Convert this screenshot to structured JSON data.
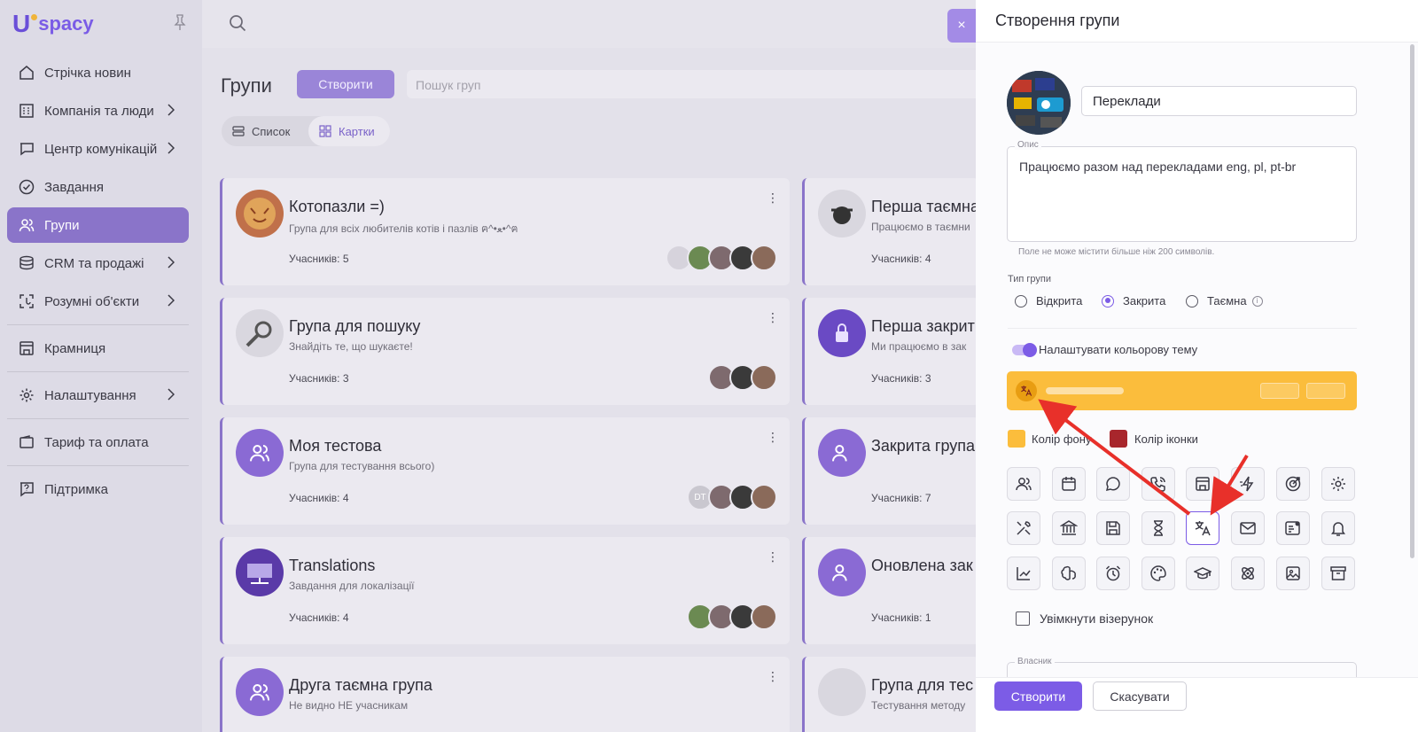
{
  "app": {
    "logo_u": "U",
    "logo_text": "spacy"
  },
  "sidebar": {
    "items": [
      {
        "label": "Стрічка новин",
        "icon": "news-icon",
        "chevron": false
      },
      {
        "label": "Компанія та люди",
        "icon": "company-icon",
        "chevron": true
      },
      {
        "label": "Центр комунікацій",
        "icon": "chat-icon",
        "chevron": true
      },
      {
        "label": "Завдання",
        "icon": "check-icon",
        "chevron": false
      },
      {
        "label": "Групи",
        "icon": "people-icon",
        "chevron": false,
        "active": true
      },
      {
        "label": "CRM та продажі",
        "icon": "coins-icon",
        "chevron": true
      },
      {
        "label": "Розумні об'єкти",
        "icon": "smart-object-icon",
        "chevron": true
      },
      {
        "label": "Крамниця",
        "icon": "store-icon",
        "chevron": false
      },
      {
        "label": "Налаштування",
        "icon": "gear-icon",
        "chevron": true
      },
      {
        "label": "Тариф та оплата",
        "icon": "wallet-icon",
        "chevron": false
      },
      {
        "label": "Підтримка",
        "icon": "help-icon",
        "chevron": false
      }
    ]
  },
  "groups_page": {
    "title": "Групи",
    "create_label": "Створити",
    "search_placeholder": "Пошук груп",
    "view_list": "Список",
    "view_cards": "Картки"
  },
  "cards": [
    {
      "title": "Котопазли =)",
      "desc": "Група для всіх любителів котів і пазлів ฅ^•ﻌ•^ฅ",
      "members": "Учасників: 5"
    },
    {
      "title": "Перша таємна",
      "desc": "Працюємо в таємни",
      "members": "Учасників: 4"
    },
    {
      "title": "Група для пошуку",
      "desc": "Знайдіть те, що шукаєте!",
      "members": "Учасників: 3"
    },
    {
      "title": "Перша закрит",
      "desc": "Ми працюємо в зак",
      "members": "Учасників: 3"
    },
    {
      "title": "Моя тестова",
      "desc": "Група для тестування всього)",
      "members": "Учасників: 4",
      "initials": "DT"
    },
    {
      "title": "Закрита група",
      "desc": "",
      "members": "Учасників: 7"
    },
    {
      "title": "Translations",
      "desc": "Завдання для локалізації",
      "members": "Учасників: 4"
    },
    {
      "title": "Оновлена зак",
      "desc": "",
      "members": "Учасників: 1"
    },
    {
      "title": "Друга таємна група",
      "desc": "Не видно НЕ учасникам",
      "members": ""
    },
    {
      "title": "Група для тес",
      "desc": "Тестування методу",
      "members": ""
    }
  ],
  "panel": {
    "title": "Створення групи",
    "close": "×",
    "name_value": "Переклади",
    "desc_label": "Опис",
    "desc_value": "Працюємо разом над перекладами eng, pl, pt-br",
    "desc_hint": "Поле не може містити більше ніж 200 символів.",
    "type_label": "Тип групи",
    "type_open": "Відкрита",
    "type_closed": "Закрита",
    "type_secret": "Таємна",
    "info_glyph": "i",
    "selected_type": "Закрита",
    "color_theme_label": "Налаштувати кольорову тему",
    "bg_color_label": "Колір фону",
    "icon_color_label": "Колір іконки",
    "bg_color": "#fbbd3c",
    "icon_color": "#a8262c",
    "pattern_label": "Увімкнути візерунок",
    "owner_label": "Власник",
    "create_button": "Створити",
    "cancel_button": "Скасувати",
    "selected_icon": "translate-icon",
    "icons": [
      "people-icon",
      "calendar-icon",
      "chat-icon",
      "phone-icon",
      "store-icon",
      "lightning-icon",
      "target-icon",
      "gear-icon",
      "tools-icon",
      "bank-icon",
      "save-icon",
      "hourglass-icon",
      "translate-icon",
      "mail-icon",
      "id-card-icon",
      "bell-icon",
      "chart-icon",
      "brain-icon",
      "alarm-icon",
      "palette-icon",
      "graduation-icon",
      "atom-icon",
      "image-icon",
      "archive-icon"
    ]
  },
  "colors": {
    "accent": "#7c5ce6",
    "sidebar_active": "#8a74c9",
    "arrow": "#e8302a"
  }
}
